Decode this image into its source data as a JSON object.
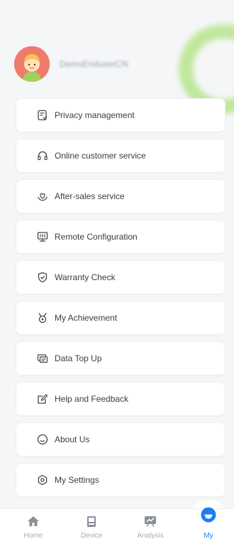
{
  "profile": {
    "username": "DemoEnduserCN"
  },
  "menu": {
    "items": [
      {
        "label": "Privacy management",
        "icon": "privacy-doc-icon"
      },
      {
        "label": "Online customer service",
        "icon": "headset-icon"
      },
      {
        "label": "After-sales service",
        "icon": "heart-hand-icon"
      },
      {
        "label": "Remote Configuration",
        "icon": "remote-config-icon"
      },
      {
        "label": "Warranty Check",
        "icon": "shield-check-icon"
      },
      {
        "label": "My Achievement",
        "icon": "medal-icon"
      },
      {
        "label": "Data Top Up",
        "icon": "data-card-icon"
      },
      {
        "label": "Help and Feedback",
        "icon": "edit-feedback-icon"
      },
      {
        "label": "About Us",
        "icon": "info-circle-icon"
      },
      {
        "label": "My Settings",
        "icon": "settings-gear-icon"
      }
    ]
  },
  "tabbar": {
    "tabs": [
      {
        "label": "Home",
        "icon": "home-icon"
      },
      {
        "label": "Device",
        "icon": "device-icon"
      },
      {
        "label": "Analysis",
        "icon": "analysis-icon"
      },
      {
        "label": "My",
        "icon": "my-icon"
      }
    ],
    "active": "My",
    "accent_color": "#1b7ff0"
  }
}
